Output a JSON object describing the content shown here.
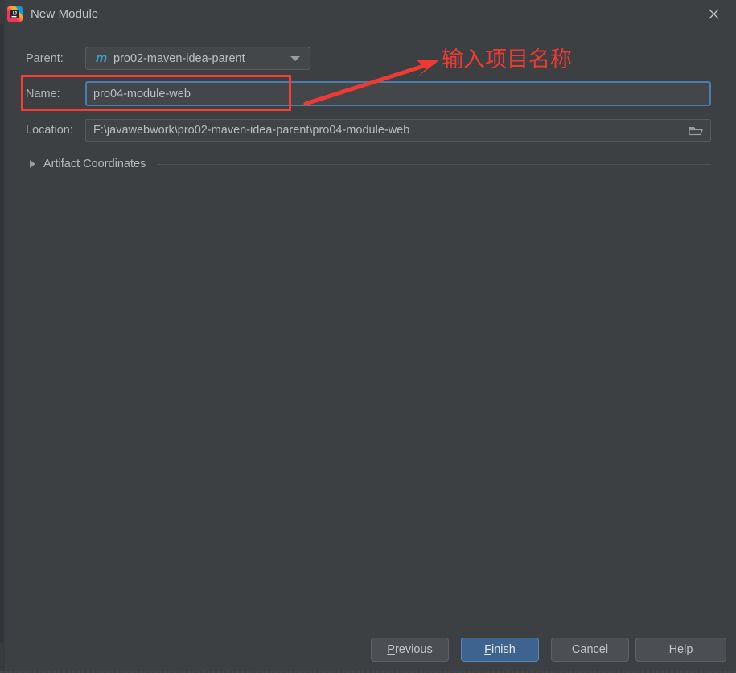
{
  "window": {
    "title": "New Module",
    "app_icon": "intellij-idea-icon",
    "close_icon": "close-icon"
  },
  "form": {
    "parent": {
      "label": "Parent:",
      "value": "pro02-maven-idea-parent",
      "icon": "maven-module-icon",
      "icon_glyph": "m",
      "dropdown_icon": "chevron-down-icon"
    },
    "name": {
      "label": "Name:",
      "value": "pro04-module-web",
      "placeholder": ""
    },
    "location": {
      "label": "Location:",
      "value": "F:\\javawebwork\\pro02-maven-idea-parent\\pro04-module-web",
      "placeholder": "",
      "browse_icon": "folder-icon"
    }
  },
  "sections": {
    "artifact_coordinates": {
      "label": "Artifact Coordinates",
      "expanded": false,
      "toggle_icon": "chevron-right-icon"
    }
  },
  "annotations": {
    "callout_text": "输入项目名称",
    "color": "#ef3a33",
    "highlight_box_target": "name-field-row",
    "arrow_icon": "red-arrow-icon"
  },
  "footer": {
    "buttons": [
      {
        "label": "Previous",
        "mnemonic": "P",
        "primary": false
      },
      {
        "label": "Finish",
        "mnemonic": "F",
        "primary": true
      },
      {
        "label": "Cancel",
        "mnemonic": "",
        "primary": false
      },
      {
        "label": "Help",
        "mnemonic": "",
        "primary": false
      }
    ]
  },
  "colors": {
    "background": "#3c4043",
    "field_background": "#44474a",
    "focus_border": "#4a7dae",
    "primary_button": "#3d638f",
    "annotation_red": "#ef3a33",
    "maven_blue": "#3d9ecb"
  }
}
